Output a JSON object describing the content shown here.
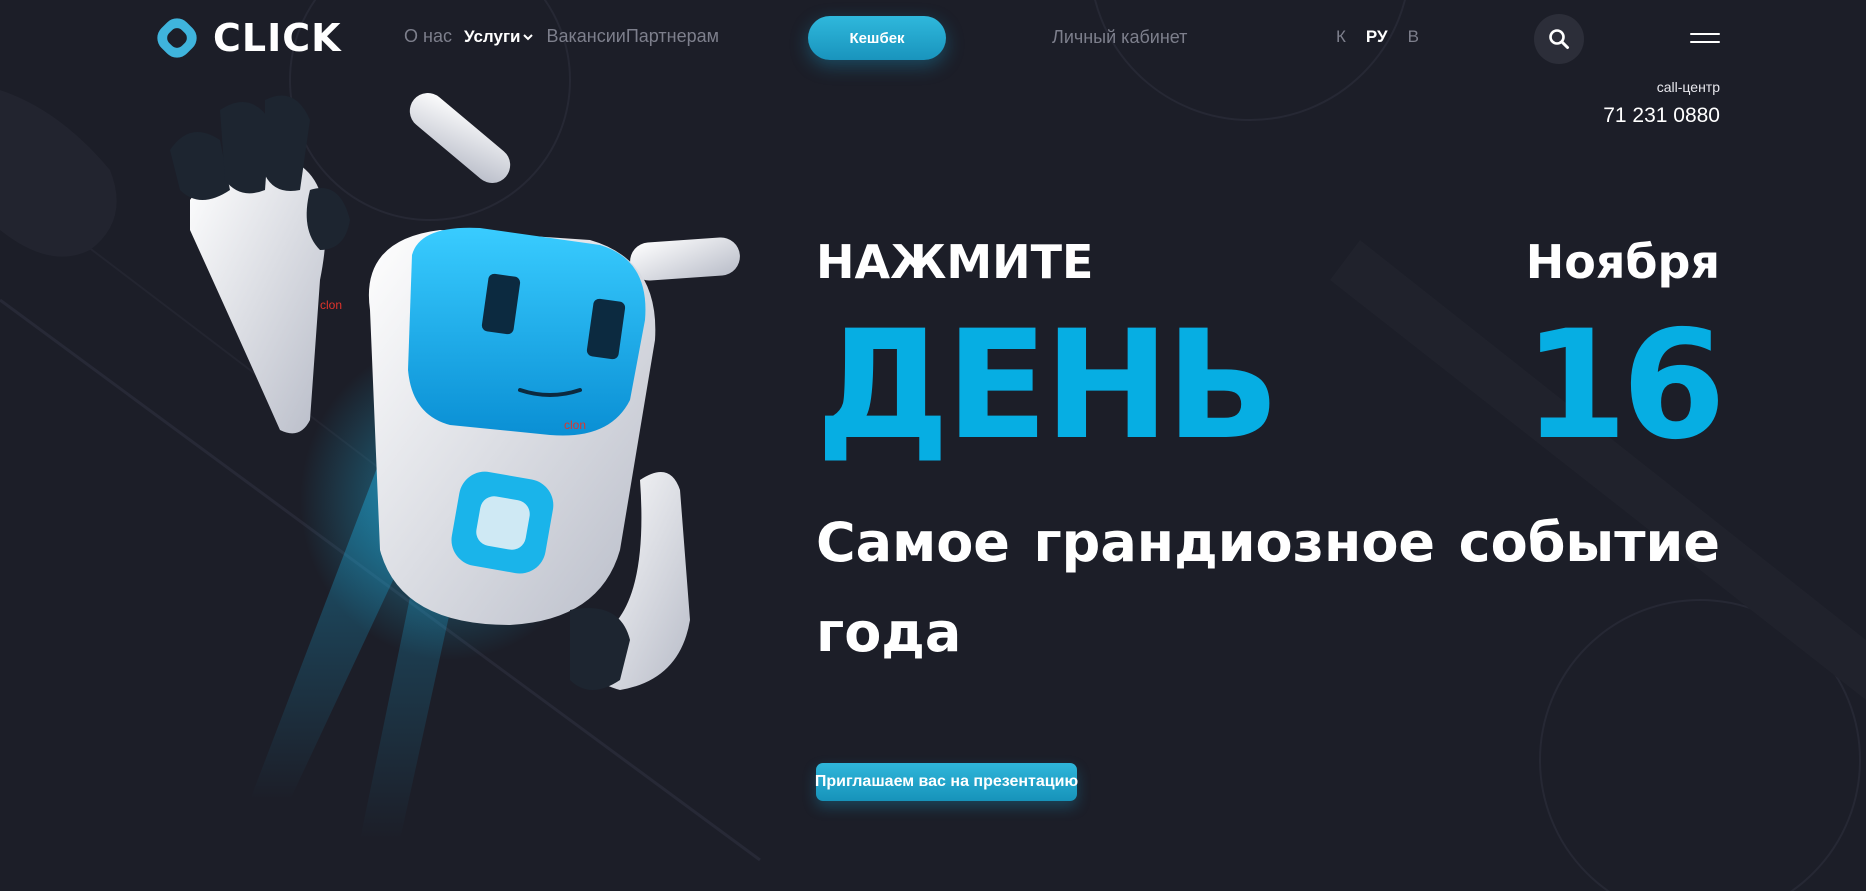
{
  "header": {
    "logo_text": "CLICK",
    "nav": {
      "about": "О нас",
      "services": "Услуги",
      "vacancies": "Вакансии",
      "partners": "Партнерам"
    },
    "cashback_label": "Кешбек",
    "cabinet_label": "Личный кабинет",
    "languages": [
      {
        "label": "К",
        "active": false
      },
      {
        "label": "РУ",
        "active": true
      },
      {
        "label": "В",
        "active": false
      }
    ],
    "call_center": {
      "label": "call-центр",
      "phone": "71 231 0880"
    }
  },
  "robot": {
    "tags": [
      "clon",
      "clon"
    ]
  },
  "hero": {
    "press_label": "НАЖМИТЕ",
    "month": "Ноября",
    "day_label": "ДЕНЬ",
    "day_number": "16",
    "subtitle": "Самое грандиозное событие года",
    "invite_button": "Приглашаем вас на презентацию"
  },
  "colors": {
    "background": "#1c1e28",
    "accent": "#06aee3",
    "button": "#1fa6cf",
    "muted_text": "#7d7f8c"
  },
  "icons": [
    "click-logo-icon",
    "chevron-down-icon",
    "search-icon",
    "menu-icon"
  ]
}
